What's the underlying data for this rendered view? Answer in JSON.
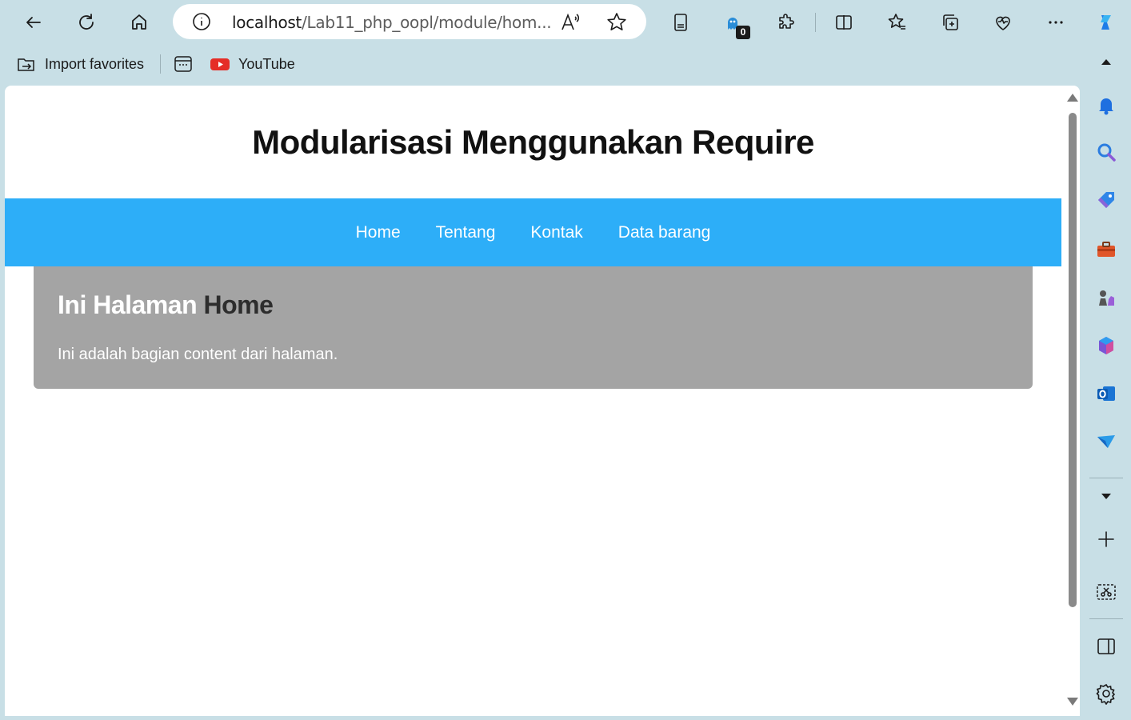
{
  "browser": {
    "address": {
      "host": "localhost",
      "path": "/Lab11_php_oopl/module/hom..."
    },
    "extension_badge": "0",
    "favorites_bar": {
      "import_label": "Import favorites",
      "youtube_label": "YouTube"
    }
  },
  "page": {
    "title": "Modularisasi Menggunakan Require",
    "nav": [
      "Home",
      "Tentang",
      "Kontak",
      "Data barang"
    ],
    "content": {
      "heading_light": "Ini Halaman",
      "heading_dark": "Home",
      "text": "Ini adalah bagian content dari halaman."
    }
  },
  "colors": {
    "browser_chrome": "#c8dfe6",
    "nav_background": "#2daef8",
    "content_background": "#a4a4a4"
  }
}
